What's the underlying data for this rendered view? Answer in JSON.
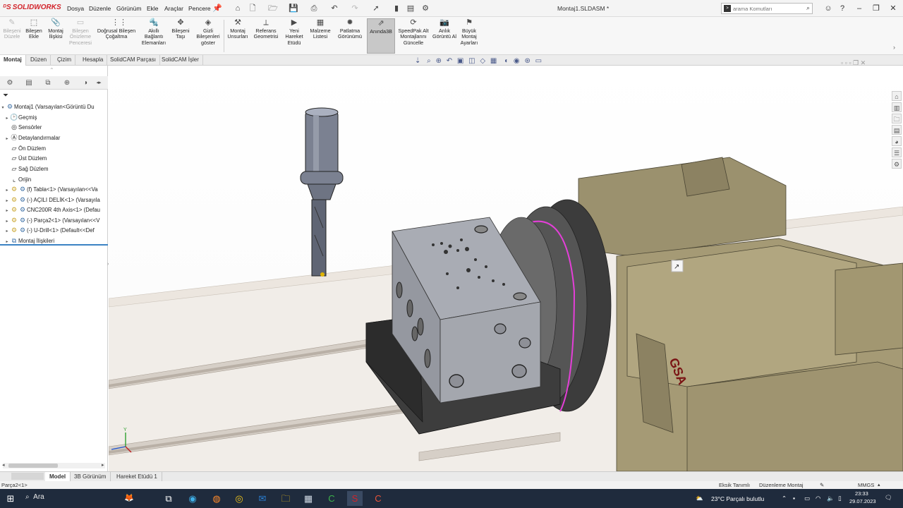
{
  "app": {
    "logo_text": "SOLIDWORKS",
    "document_title": "Montaj1.SLDASM *",
    "menu": [
      "Dosya",
      "Düzenle",
      "Görünüm",
      "Ekle",
      "Araçlar",
      "Pencere"
    ],
    "search": {
      "placeholder": "arama Komutları"
    }
  },
  "command_manager": {
    "buttons": [
      {
        "label": "Bileşeni Düzele",
        "icon": "edit-component-icon",
        "state": "disabled"
      },
      {
        "label": "Bileşen Ekle",
        "icon": "insert-component-icon",
        "state": "normal"
      },
      {
        "label": "Montaj İlişkisi",
        "icon": "mate-icon",
        "state": "normal"
      },
      {
        "label": "Bileşen Önizleme Penceresi",
        "icon": "preview-window-icon",
        "state": "disabled"
      },
      {
        "label": "Doğrusal Bileşen Çoğaltma",
        "icon": "linear-pattern-icon",
        "state": "normal"
      },
      {
        "label": "Akıllı Bağlantı Elemanları",
        "icon": "smart-fasteners-icon",
        "state": "normal"
      },
      {
        "label": "Bileşeni Taşı",
        "icon": "move-component-icon",
        "state": "normal"
      },
      {
        "label": "Gizli Bileşenleri göster",
        "icon": "show-hidden-icon",
        "state": "normal"
      },
      {
        "label": "Montaj Unsurları",
        "icon": "assembly-features-icon",
        "state": "normal"
      },
      {
        "label": "Referans Geometrisi",
        "icon": "reference-geometry-icon",
        "state": "normal"
      },
      {
        "label": "Yeni Hareket Etüdü",
        "icon": "motion-study-icon",
        "state": "normal"
      },
      {
        "label": "Malzeme Listesi",
        "icon": "bom-icon",
        "state": "normal"
      },
      {
        "label": "Patlatma Görünümü",
        "icon": "exploded-view-icon",
        "state": "normal"
      },
      {
        "label": "Anında3B",
        "icon": "instant3d-icon",
        "state": "active"
      },
      {
        "label": "SpeedPak Alt Montajlarını Güncelle",
        "icon": "speedpak-icon",
        "state": "normal"
      },
      {
        "label": "Anlık Görüntü Al",
        "icon": "snapshot-icon",
        "state": "normal"
      },
      {
        "label": "Büyük Montaj Ayarları",
        "icon": "large-assembly-icon",
        "state": "normal"
      }
    ]
  },
  "tabs": [
    "Montaj",
    "Düzen",
    "Çizim",
    "Hesapla",
    "SolidCAM Parçası",
    "SolidCAM İşler"
  ],
  "feature_tree": {
    "root": "Montaj1  (Varsayılan<Görüntü Du",
    "items": [
      {
        "label": "Geçmiş",
        "icon": "history-icon",
        "expander": true
      },
      {
        "label": "Sensörler",
        "icon": "sensor-icon",
        "expander": false
      },
      {
        "label": "Detaylandırmalar",
        "icon": "annotations-icon",
        "expander": true
      },
      {
        "label": "Ön Düzlem",
        "icon": "plane-icon",
        "expander": false
      },
      {
        "label": "Üst Düzlem",
        "icon": "plane-icon",
        "expander": false
      },
      {
        "label": "Sağ Düzlem",
        "icon": "plane-icon",
        "expander": false
      },
      {
        "label": "Orijin",
        "icon": "origin-icon",
        "expander": false
      },
      {
        "label": "(f) Tabla<1> (Varsayılan<<Va",
        "icon": "part-icon",
        "expander": true
      },
      {
        "label": "(-) AÇILI DELİK<1> (Varsayıla",
        "icon": "part-icon",
        "expander": true
      },
      {
        "label": "CNC200R 4th Axis<1> (Defau",
        "icon": "part-icon",
        "expander": true
      },
      {
        "label": "(-) Parça2<1> (Varsayılan<<V",
        "icon": "part-icon",
        "expander": true
      },
      {
        "label": "(-) U-Drill<1> (Default<<Def",
        "icon": "part-icon",
        "expander": true
      },
      {
        "label": "Montaj İlişkileri",
        "icon": "mates-folder-icon",
        "expander": true
      }
    ]
  },
  "viewport": {
    "label_text": "GSA"
  },
  "bottom_tabs": [
    "Model",
    "3B Görünüm",
    "Hareket Etüdü 1"
  ],
  "status_bar": {
    "left": "Parça2<1>",
    "definition": "Eksik Tanımlı",
    "mode": "Düzenleme Montaj",
    "units": "MMGS"
  },
  "taskbar": {
    "search_placeholder": "Ara",
    "weather": "23°C  Parçalı bulutlu",
    "time": "23:33",
    "date": "29.07.2023"
  },
  "colors": {
    "accent_red": "#d2232a",
    "taskbar_bg": "#1f2b3d",
    "machine_tan": "#a59a75",
    "workpiece_grey": "#a4a7ae",
    "highlight_magenta": "#e43fd8"
  }
}
